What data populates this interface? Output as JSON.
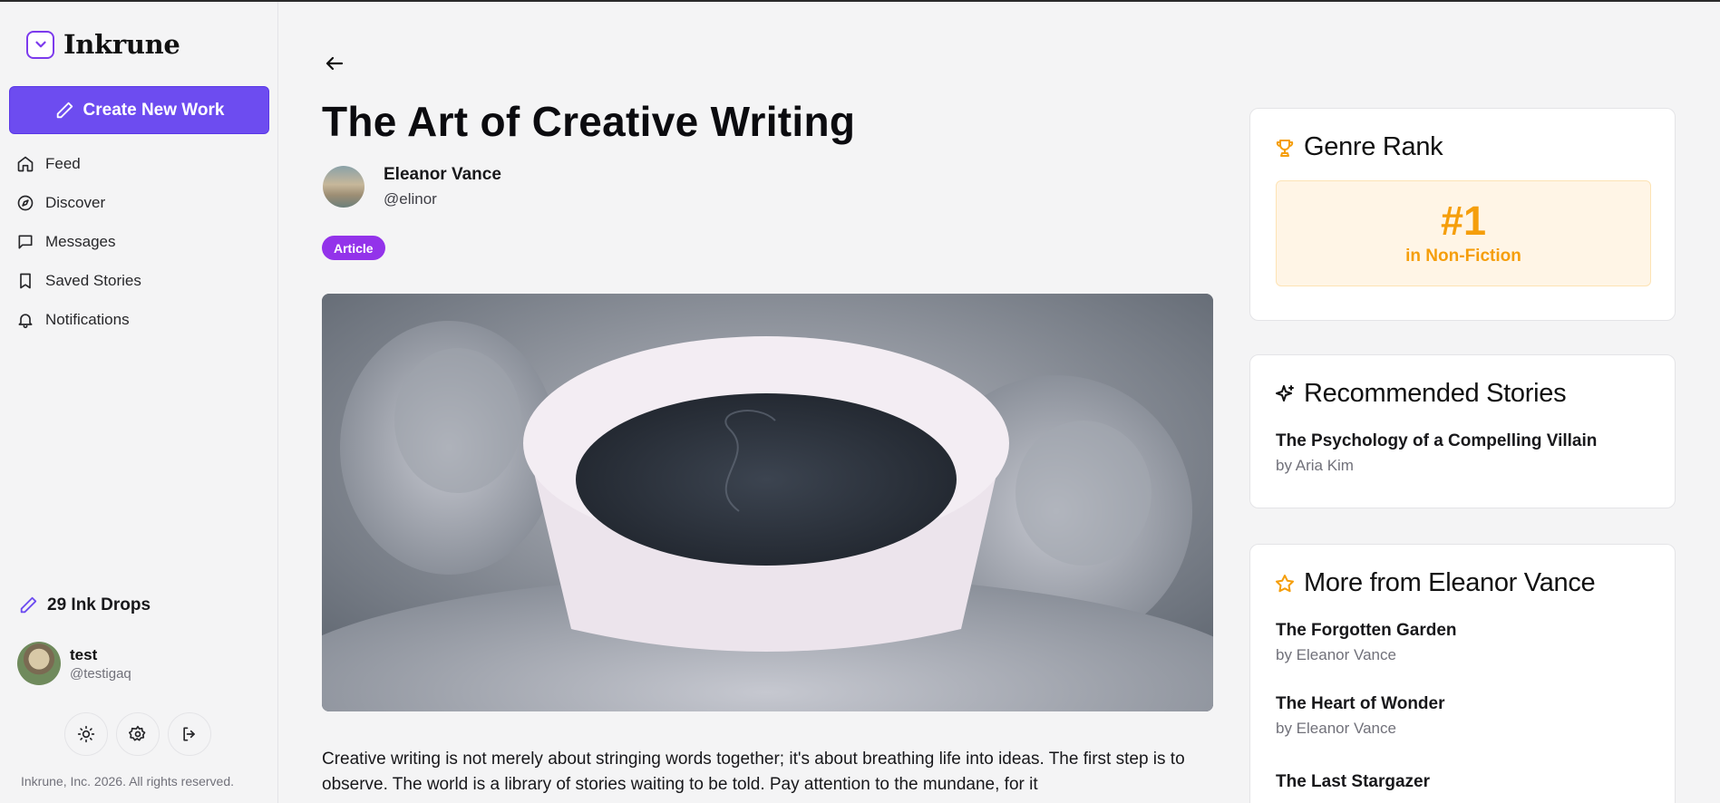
{
  "app": {
    "name": "Inkrune",
    "copyright": "Inkrune, Inc. 2026. All rights reserved."
  },
  "sidebar": {
    "create_label": "Create New Work",
    "items": [
      {
        "label": "Feed",
        "icon": "home-icon"
      },
      {
        "label": "Discover",
        "icon": "compass-icon"
      },
      {
        "label": "Messages",
        "icon": "message-icon"
      },
      {
        "label": "Saved Stories",
        "icon": "bookmark-icon"
      },
      {
        "label": "Notifications",
        "icon": "bell-icon"
      }
    ],
    "ink_drops": "29 Ink Drops",
    "user": {
      "name": "test",
      "handle": "@testigaq"
    }
  },
  "article": {
    "title": "The Art of Creative Writing",
    "author_name": "Eleanor Vance",
    "author_handle": "@elinor",
    "tag": "Article",
    "body": "Creative writing is not merely about stringing words together; it's about breathing life into ideas. The first step is to observe. The world is a library of stories waiting to be told. Pay attention to the mundane, for it"
  },
  "genre_rank": {
    "title": "Genre Rank",
    "rank": "#1",
    "label": "in Non-Fiction"
  },
  "recommended": {
    "title": "Recommended Stories",
    "stories": [
      {
        "title": "The Psychology of a Compelling Villain",
        "by": "by Aria Kim"
      }
    ]
  },
  "more_from": {
    "title": "More from Eleanor Vance",
    "stories": [
      {
        "title": "The Forgotten Garden",
        "by": "by Eleanor Vance"
      },
      {
        "title": "The Heart of Wonder",
        "by": "by Eleanor Vance"
      },
      {
        "title": "The Last Stargazer",
        "by": ""
      }
    ]
  },
  "colors": {
    "accent": "#6d4cf0",
    "tag": "#9333ea",
    "rank": "#f59e0b"
  }
}
